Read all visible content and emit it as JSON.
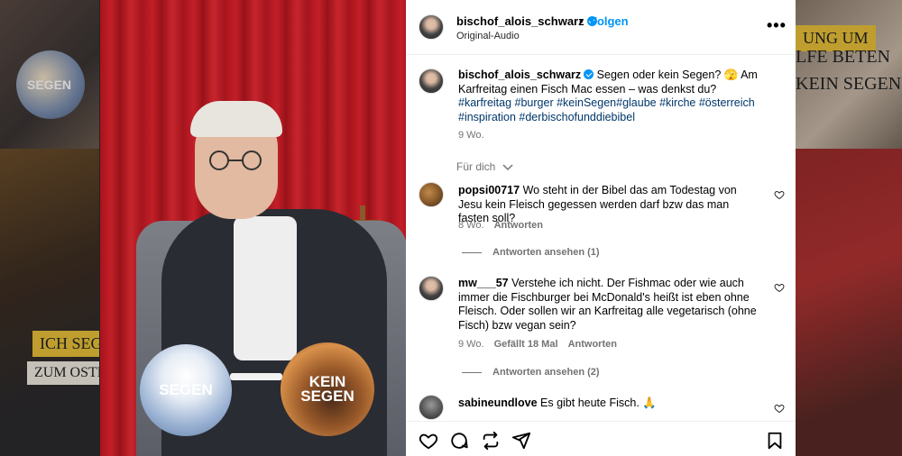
{
  "background": {
    "left_top_text": "SEGEN",
    "left_banner_1": "ICH SEG",
    "left_banner_2": "ZUM OSTE",
    "right_banner_1": "UNG UM",
    "right_banner_2": "LFE BETEN",
    "right_text": "KEIN SEGEN?"
  },
  "video": {
    "bubble_left": "SEGEN",
    "bubble_right": "KEIN SEGEN"
  },
  "header": {
    "username": "bischof_alois_schwarz",
    "separator": "•",
    "follow_label": "Folgen",
    "audio": "Original-Audio",
    "more": "•••"
  },
  "caption": {
    "username": "bischof_alois_schwarz",
    "text": "Segen oder kein Segen? 🫣 Am Karfreitag einen Fisch Mac essen – was denkst du?",
    "hashtags": "#karfreitag #burger #keinSegen#glaube #kirche #österreich #inspiration #derbischofunddiebibel",
    "time": "9 Wo.",
    "translate": "Für dich"
  },
  "comments": [
    {
      "username": "popsi00717",
      "text": "Wo steht in der Bibel das am Todestag von Jesu kein Fleisch gegessen werden darf bzw das man fasten soll?",
      "time": "8 Wo.",
      "likes": "",
      "reply": "Antworten",
      "view_replies": "Antworten ansehen (1)"
    },
    {
      "username": "mw___57",
      "text": "Verstehe ich nicht. Der Fishmac oder wie auch immer die Fischburger bei McDonald's heißt ist eben ohne Fleisch. Oder sollen wir an Karfreitag alle vegetarisch (ohne Fisch) bzw vegan sein?",
      "time": "9 Wo.",
      "likes": "Gefällt 18 Mal",
      "reply": "Antworten",
      "view_replies": "Antworten ansehen (2)"
    },
    {
      "username": "sabineundlove",
      "text": "Es gibt heute Fisch. 🙏",
      "time": "",
      "likes": "",
      "reply": "",
      "view_replies": ""
    }
  ],
  "actions": {
    "like": "heart-icon",
    "comment": "comment-icon",
    "repost": "repost-icon",
    "share": "share-icon",
    "save": "bookmark-icon"
  },
  "colors": {
    "link": "#0095f6",
    "hashtag": "#00376b",
    "muted": "#737373"
  }
}
